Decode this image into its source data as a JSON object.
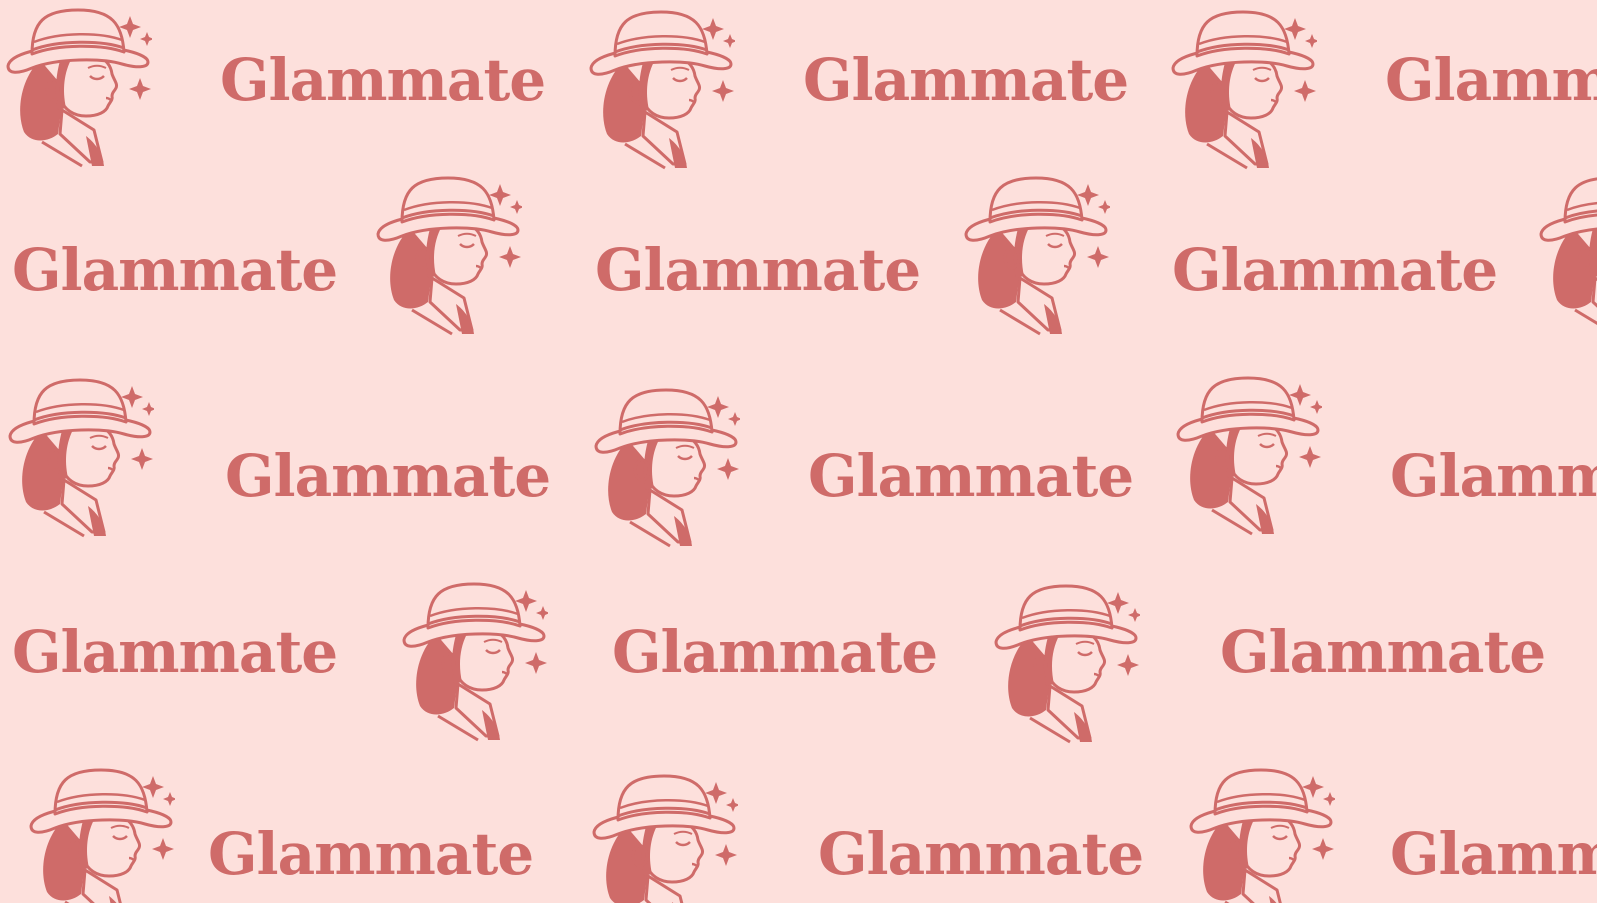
{
  "brand": {
    "name": "Glammate",
    "color": "#cf6b69",
    "background": "#fde0dc",
    "icon": "woman-with-hat-icon"
  }
}
